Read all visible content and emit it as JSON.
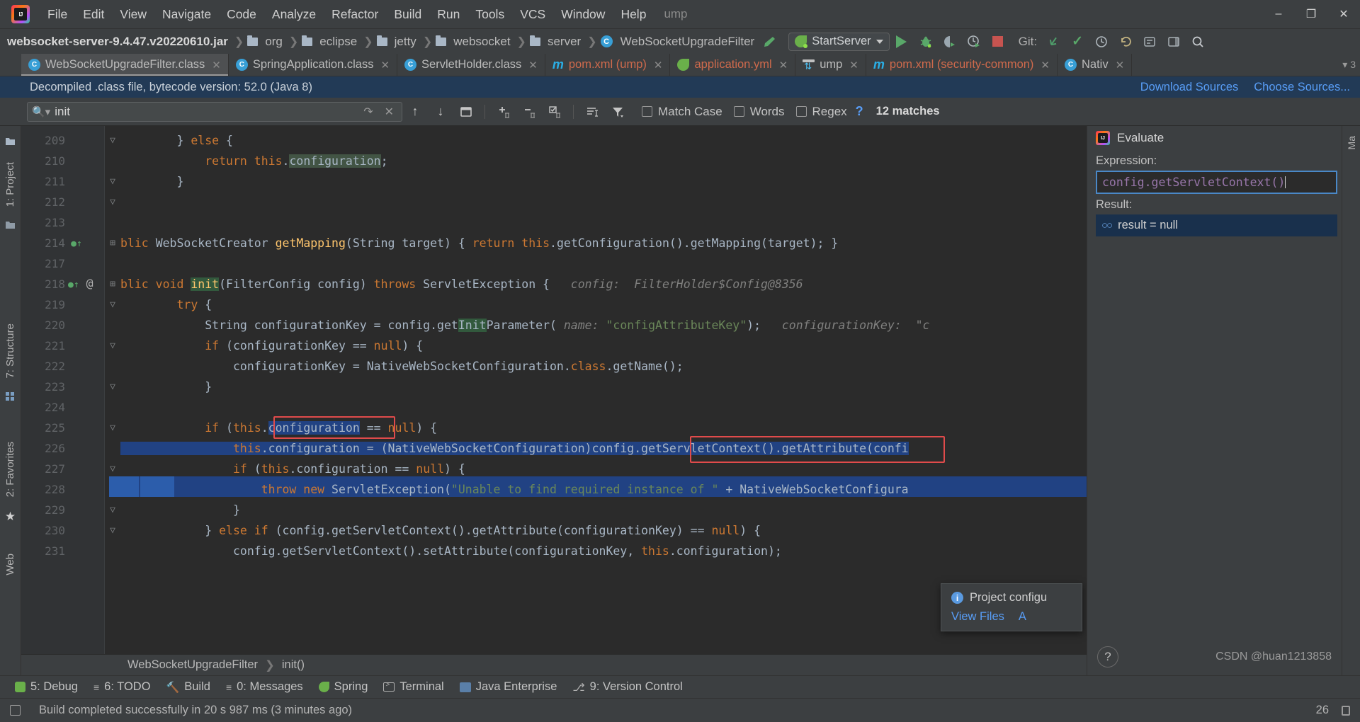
{
  "window": {
    "project_name": "ump",
    "minimize": "–",
    "maximize": "❐",
    "close": "✕"
  },
  "menu": {
    "items": [
      "File",
      "Edit",
      "View",
      "Navigate",
      "Code",
      "Analyze",
      "Refactor",
      "Build",
      "Run",
      "Tools",
      "VCS",
      "Window",
      "Help"
    ]
  },
  "navbar": {
    "breadcrumbs": [
      {
        "label": "websocket-server-9.4.47.v20220610.jar",
        "icon": "none"
      },
      {
        "label": "org",
        "icon": "folder-icon"
      },
      {
        "label": "eclipse",
        "icon": "folder-icon"
      },
      {
        "label": "jetty",
        "icon": "folder-icon"
      },
      {
        "label": "websocket",
        "icon": "folder-icon"
      },
      {
        "label": "server",
        "icon": "folder-icon"
      },
      {
        "label": "WebSocketUpgradeFilter",
        "icon": "class-icon"
      }
    ],
    "run_config": "StartServer",
    "git_label": "Git:",
    "icons": [
      "build-hammer-icon",
      "run-icon",
      "debug-icon",
      "run-coverage-icon",
      "profile-icon",
      "stop-icon",
      "git-update-icon",
      "git-commit-icon",
      "git-history-icon",
      "git-rollback-icon",
      "settings-icon",
      "layout-icon",
      "search-everywhere-icon"
    ]
  },
  "tabs": [
    {
      "label": "WebSocketUpgradeFilter.class",
      "icon": "class-icon",
      "active": true,
      "color": "normal"
    },
    {
      "label": "SpringApplication.class",
      "icon": "spring-class-icon",
      "active": false,
      "color": "normal"
    },
    {
      "label": "ServletHolder.class",
      "icon": "class-icon",
      "active": false,
      "color": "normal"
    },
    {
      "label": "pom.xml (ump)",
      "icon": "maven-icon",
      "active": false,
      "color": "red"
    },
    {
      "label": "application.yml",
      "icon": "spring-icon",
      "active": false,
      "color": "red"
    },
    {
      "label": "ump",
      "icon": "database-icon",
      "active": false,
      "color": "normal"
    },
    {
      "label": "pom.xml (security-common)",
      "icon": "maven-icon",
      "active": false,
      "color": "red"
    },
    {
      "label": "Nativ",
      "icon": "class-icon",
      "active": false,
      "color": "normal"
    }
  ],
  "tabbar_overflow": "▾ 3",
  "notice": {
    "text": "Decompiled .class file, bytecode version: 52.0 (Java 8)",
    "links": [
      "Download Sources",
      "Choose Sources..."
    ]
  },
  "find": {
    "query": "init",
    "placeholder": "Search",
    "match_case": "Match Case",
    "words": "Words",
    "regex": "Regex",
    "help": "?",
    "matches": "12 matches",
    "icons": [
      "prev-match-icon",
      "next-match-icon",
      "select-all-icon",
      "add-occurrence-icon",
      "remove-occurrence-icon",
      "select-all-occurrences-icon",
      "filter-lines-icon",
      "filter-icon",
      "history-icon",
      "close-icon"
    ]
  },
  "left_strip": {
    "items": [
      "1: Project",
      "7: Structure",
      "2: Favorites",
      "Web"
    ]
  },
  "editor": {
    "first_line": 209,
    "lines": [
      {
        "num": "209",
        "indent": 0,
        "text": "        } else {"
      },
      {
        "num": "210",
        "indent": 0,
        "text": "            return this.configuration;"
      },
      {
        "num": "211",
        "indent": 0,
        "text": "        }"
      },
      {
        "num": "212",
        "indent": 0,
        "text": ""
      },
      {
        "num": "213",
        "indent": 0,
        "text": ""
      },
      {
        "num": "214",
        "indent": 0,
        "text": "    public WebSocketCreator getMapping(String target) { return this.getConfiguration().getMapping(target); }"
      },
      {
        "num": "217",
        "indent": 0,
        "text": ""
      },
      {
        "num": "218",
        "indent": 0,
        "text": "    public void init(FilterConfig config) throws ServletException {"
      },
      {
        "num": "219",
        "indent": 0,
        "text": "        try {"
      },
      {
        "num": "220",
        "indent": 0,
        "text": "            String configurationKey = config.getInitParameter( name: \"configAttributeKey\");"
      },
      {
        "num": "221",
        "indent": 0,
        "text": "            if (configurationKey == null) {"
      },
      {
        "num": "222",
        "indent": 0,
        "text": "                configurationKey = NativeWebSocketConfiguration.class.getName();"
      },
      {
        "num": "223",
        "indent": 0,
        "text": "            }"
      },
      {
        "num": "224",
        "indent": 0,
        "text": ""
      },
      {
        "num": "225",
        "indent": 0,
        "text": "            if (this.configuration == null) {"
      },
      {
        "num": "226",
        "indent": 0,
        "text": "                this.configuration = (NativeWebSocketConfiguration)config.getServletContext().getAttribute(confi"
      },
      {
        "num": "227",
        "indent": 0,
        "text": "                if (this.configuration == null) {"
      },
      {
        "num": "228",
        "indent": 0,
        "text": "                    throw new ServletException(\"Unable to find required instance of \" + NativeWebSocketConfigura"
      },
      {
        "num": "229",
        "indent": 0,
        "text": "                }"
      },
      {
        "num": "230",
        "indent": 0,
        "text": "            } else if (config.getServletContext().getAttribute(configurationKey) == null) {"
      },
      {
        "num": "231",
        "indent": 0,
        "text": "                config.getServletContext().setAttribute(configurationKey, this.configuration);"
      }
    ],
    "inline_hint_218": "config:  FilterHolder$Config@8356",
    "inline_hint_220": "configurationKey:  \"c",
    "breadcrumb": [
      "WebSocketUpgradeFilter",
      "init()"
    ]
  },
  "project_popup": {
    "title": "Project configu",
    "links": [
      "View Files",
      "A"
    ]
  },
  "evaluate": {
    "title": "Evaluate",
    "expression_label": "Expression:",
    "expression": "config.getServletContext()",
    "result_label": "Result:",
    "result": "result = null",
    "result_icon": "object-ref-icon",
    "help": "?",
    "watermark": "CSDN @huan1213858"
  },
  "bottom_tools": [
    {
      "label": "5: Debug",
      "icon": "debug-icon"
    },
    {
      "label": "6: TODO",
      "icon": "todo-icon"
    },
    {
      "label": "Build",
      "icon": "build-icon"
    },
    {
      "label": "0: Messages",
      "icon": "messages-icon"
    },
    {
      "label": "Spring",
      "icon": "spring-icon"
    },
    {
      "label": "Terminal",
      "icon": "terminal-icon"
    },
    {
      "label": "Java Enterprise",
      "icon": "java-enterprise-icon"
    },
    {
      "label": "9: Version Control",
      "icon": "version-control-icon"
    }
  ],
  "status": {
    "message": "Build completed successfully in 20 s 987 ms (3 minutes ago)",
    "right_number": "26"
  },
  "colors": {
    "bg": "#3c3f41",
    "editor_bg": "#2b2b2b",
    "gutter_bg": "#313335",
    "notice_bg": "#223a56",
    "accent_blue": "#589df6",
    "selection_blue": "#214283",
    "green": "#59a869",
    "red": "#c75450",
    "keyword_orange": "#cc7832",
    "string_green": "#6a8759",
    "highlight_box_red": "#e04b4b"
  }
}
